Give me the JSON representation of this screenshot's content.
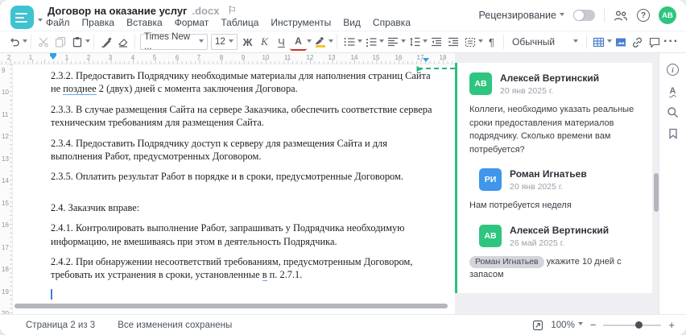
{
  "window": {
    "title": "Договор на оказание услуг",
    "title_ext": ".docx"
  },
  "menu": {
    "items": [
      "Файл",
      "Правка",
      "Вставка",
      "Формат",
      "Таблица",
      "Инструменты",
      "Вид",
      "Справка"
    ]
  },
  "header_right": {
    "review_label": "Рецензирование",
    "avatar_initials": "АВ",
    "help_glyph": "?"
  },
  "toolbar": {
    "font_name": "Times New ...",
    "font_size": "12",
    "bold_label": "Ж",
    "italic_label": "К",
    "underline_label": "Ч",
    "font_color_label": "А",
    "style_name": "Обычный",
    "pilcrow": "¶",
    "more_label": "···"
  },
  "hruler": {
    "labels": [
      [
        "2",
        11
      ],
      [
        "1",
        38
      ],
      [
        "1",
        83
      ],
      [
        "2",
        110
      ],
      [
        "3",
        137
      ],
      [
        "4",
        165
      ],
      [
        "5",
        192
      ],
      [
        "6",
        220
      ],
      [
        "7",
        247
      ],
      [
        "8",
        275
      ],
      [
        "9",
        302
      ],
      [
        "10",
        330
      ],
      [
        "11",
        357
      ],
      [
        "12",
        385
      ],
      [
        "13",
        412
      ],
      [
        "14",
        440
      ],
      [
        "15",
        467
      ],
      [
        "16",
        495
      ],
      [
        "17",
        522
      ],
      [
        "18",
        550
      ]
    ]
  },
  "vruler": {
    "labels": [
      [
        "9",
        3
      ],
      [
        "10",
        30
      ],
      [
        "11",
        58
      ],
      [
        "12",
        85
      ],
      [
        "13",
        113
      ],
      [
        "14",
        140
      ],
      [
        "15",
        168
      ],
      [
        "16",
        195
      ],
      [
        "17",
        223
      ],
      [
        "18",
        250
      ],
      [
        "19",
        278
      ],
      [
        "20",
        305
      ]
    ]
  },
  "document": {
    "p232_a": "2.3.2. Предоставить Подрядчику необходимые материалы для наполнения страниц Сайта не ",
    "p232_b": "позднее",
    "p232_c": " 2 (двух) дней с момента заключения Договора.",
    "p233": "2.3.3. В случае размещения Сайта на сервере Заказчика, обеспечить соответствие сервера техническим требованиям для размещения Сайта.",
    "p234": "2.3.4. Предоставить Подрядчику доступ к серверу для размещения Сайта и для выполнения Работ, предусмотренных Договором.",
    "p235": "2.3.5. Оплатить результат Работ в порядке и в сроки, предусмотренные Договором.",
    "p24": "2.4. Заказчик вправе:",
    "p241": "2.4.1. Контролировать выполнение Работ, запрашивать у Подрядчика необходимую информацию, не вмешиваясь при этом в деятельность Подрядчика.",
    "p242_a": "2.4.2. При обнаружении несоответствий требованиям, предусмотренным Договором, требовать их устранения в сроки, установленные ",
    "p242_b": "в",
    "p242_c": " п. 2.7.1."
  },
  "comments": {
    "items": [
      {
        "initials": "АВ",
        "name": "Алексей Вертинский",
        "date": "20 янв 2025 г.",
        "text": "Коллеги, необходимо указать реальные сроки предоставления материалов подрядчику. Сколько времени вам потребуется?",
        "color": "#2fc57f"
      },
      {
        "initials": "РИ",
        "name": "Роман Игнатьев",
        "date": "20 янв 2025 г.",
        "text": "Нам потребуется неделя",
        "color": "#3f96ea"
      },
      {
        "initials": "АВ",
        "name": "Алексей Вертинский",
        "date": "26 май 2025 г.",
        "mention": "Роман Игнатьев",
        "text": " укажите 10 дней с запасом",
        "color": "#2fc57f"
      }
    ]
  },
  "statusbar": {
    "page_info": "Страница 2 из 3",
    "saved_info": "Все изменения сохранены",
    "zoom_value": "100%",
    "zoom_out": "−",
    "zoom_in": "+"
  },
  "colors": {
    "brand_teal": "#3ec3d0",
    "comment_green": "#2fc57f",
    "reply_blue": "#3f96ea",
    "accent_blue_icons": "#4a7fcd",
    "ruler_marker_blue": "#2f9fe8",
    "connector_green": "#25b877",
    "highlight_yellow": "#f7c52d",
    "font_color_red": "#c0392b"
  }
}
